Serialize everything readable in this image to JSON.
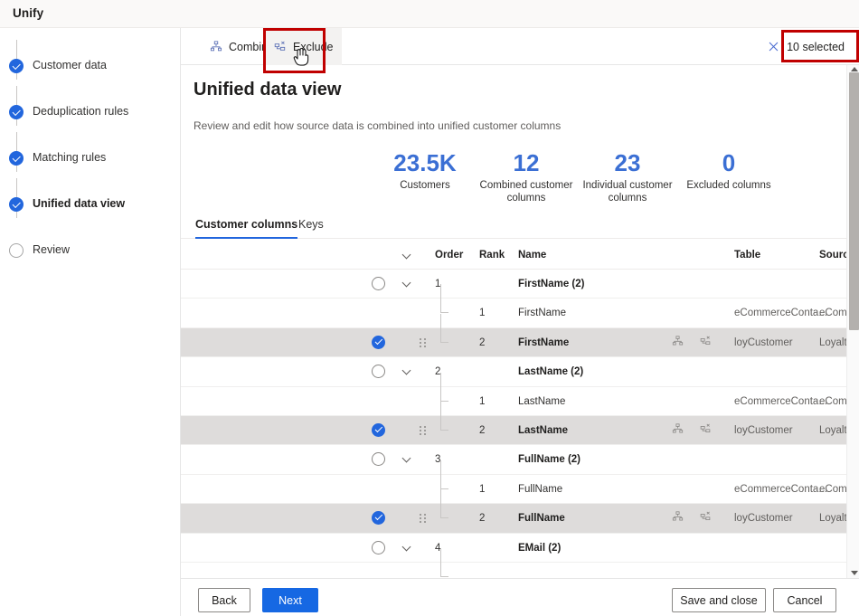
{
  "window": {
    "title": "Unify"
  },
  "sidebar": {
    "items": [
      {
        "label": "Customer data",
        "state": "done"
      },
      {
        "label": "Deduplication rules",
        "state": "done"
      },
      {
        "label": "Matching rules",
        "state": "done"
      },
      {
        "label": "Unified data view",
        "state": "current"
      },
      {
        "label": "Review",
        "state": "todo"
      }
    ]
  },
  "commandbar": {
    "combine_label": "Combine",
    "exclude_label": "Exclude",
    "selected_label": "10 selected"
  },
  "main": {
    "heading": "Unified data view",
    "subheading": "Review and edit how source data is combined into unified customer columns",
    "kpis": [
      {
        "value": "23.5K",
        "caption": "Customers"
      },
      {
        "value": "12",
        "caption": "Combined customer columns"
      },
      {
        "value": "23",
        "caption": "Individual customer columns"
      },
      {
        "value": "0",
        "caption": "Excluded columns"
      }
    ],
    "tabs": [
      {
        "label": "Customer columns",
        "active": true
      },
      {
        "label": "Keys",
        "active": false
      }
    ],
    "table": {
      "headers": {
        "expand": "",
        "order": "Order",
        "rank": "Rank",
        "name": "Name",
        "table": "Table",
        "source": "Source"
      },
      "groups": [
        {
          "order": "1",
          "name": "FirstName (2)",
          "children": [
            {
              "rank": "1",
              "name": "FirstName",
              "table": "eCommerceConta...",
              "source": "eCommerce",
              "selected": false
            },
            {
              "rank": "2",
              "name": "FirstName",
              "table": "loyCustomer",
              "source": "LoyaltyScheme",
              "selected": true
            }
          ]
        },
        {
          "order": "2",
          "name": "LastName (2)",
          "children": [
            {
              "rank": "1",
              "name": "LastName",
              "table": "eCommerceConta...",
              "source": "eCommerce",
              "selected": false
            },
            {
              "rank": "2",
              "name": "LastName",
              "table": "loyCustomer",
              "source": "LoyaltyScheme",
              "selected": true
            }
          ]
        },
        {
          "order": "3",
          "name": "FullName (2)",
          "children": [
            {
              "rank": "1",
              "name": "FullName",
              "table": "eCommerceConta...",
              "source": "eCommerce",
              "selected": false
            },
            {
              "rank": "2",
              "name": "FullName",
              "table": "loyCustomer",
              "source": "LoyaltyScheme",
              "selected": true
            }
          ]
        },
        {
          "order": "4",
          "name": "EMail (2)",
          "children": []
        }
      ]
    }
  },
  "footer": {
    "back": "Back",
    "next": "Next",
    "save_and_close": "Save and close",
    "cancel": "Cancel"
  },
  "colors": {
    "accent": "#2266dd",
    "primary_button": "#1668e3",
    "kpi_number": "#3b6fd4",
    "annotation": "#c00000",
    "selected_row": "#dedcdb"
  }
}
